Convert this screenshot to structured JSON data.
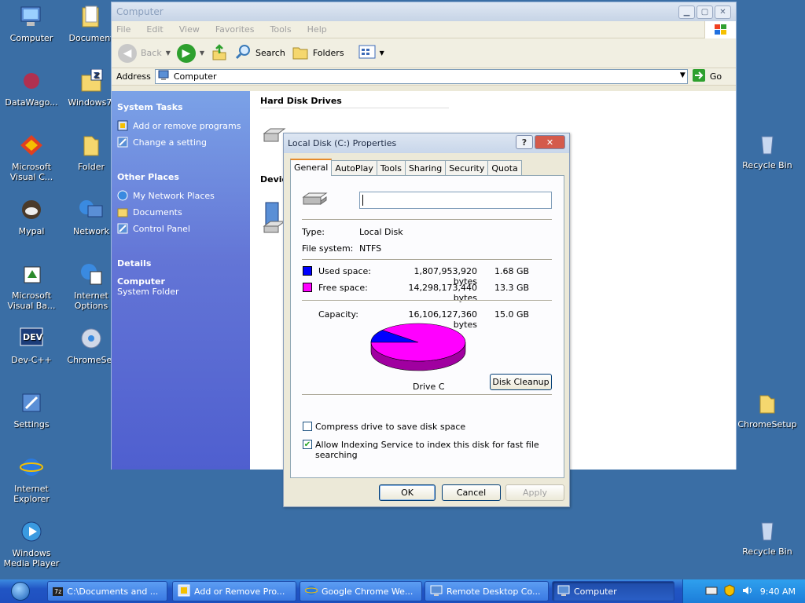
{
  "desktop": {
    "left_icons": [
      {
        "label": "Computer",
        "icon": "computer-icon"
      },
      {
        "label": "Document",
        "icon": "folder-documents-icon"
      },
      {
        "label": "DataWago...",
        "icon": "datawago-icon"
      },
      {
        "label": "Windows7I",
        "icon": "zip-archive-icon"
      },
      {
        "label": "Microsoft\nVisual C...",
        "icon": "visual-c-icon"
      },
      {
        "label": "Folder",
        "icon": "folder-icon"
      },
      {
        "label": "Mypal",
        "icon": "mypal-icon"
      },
      {
        "label": "Network",
        "icon": "network-icon"
      },
      {
        "label": "Microsoft\nVisual Ba...",
        "icon": "visual-basic-icon"
      },
      {
        "label": "Internet\nOptions",
        "icon": "internet-options-icon"
      },
      {
        "label": "Dev-C++",
        "icon": "devcpp-icon"
      },
      {
        "label": "ChromeSet",
        "icon": "chrome-setup-icon"
      },
      {
        "label": "Settings",
        "icon": "settings-icon"
      },
      {
        "label": "Internet\nExplorer",
        "icon": "internet-explorer-icon"
      },
      {
        "label": "Windows\nMedia Player",
        "icon": "media-player-icon"
      }
    ],
    "right_icons": [
      {
        "label": "Recycle Bin",
        "icon": "recycle-bin-icon"
      },
      {
        "label": "ChromeSetup",
        "icon": "folder-icon"
      },
      {
        "label": "Recycle Bin",
        "icon": "recycle-bin-icon"
      }
    ]
  },
  "explorer": {
    "title": "Computer",
    "menu": [
      "File",
      "Edit",
      "View",
      "Favorites",
      "Tools",
      "Help"
    ],
    "toolbar": {
      "back": "Back",
      "search": "Search",
      "folders": "Folders"
    },
    "address_label": "Address",
    "address_value": "Computer",
    "go_label": "Go",
    "task_pane": {
      "system_tasks_title": "System Tasks",
      "system_tasks": [
        "Add or remove programs",
        "Change a setting"
      ],
      "other_places_title": "Other Places",
      "other_places": [
        "My Network Places",
        "Documents",
        "Control Panel"
      ],
      "details_title": "Details",
      "details_name": "Computer",
      "details_type": "System Folder"
    },
    "sections": {
      "hard_disks": "Hard Disk Drives",
      "devices": "Devic"
    }
  },
  "dialog": {
    "title": "Local Disk (C:) Properties",
    "help_btn": "?",
    "close_btn": "✕",
    "tabs": [
      "General",
      "AutoPlay",
      "Tools",
      "Sharing",
      "Security",
      "Quota"
    ],
    "active_tab": "General",
    "name_value": "",
    "type_label": "Type:",
    "type_value": "Local Disk",
    "fs_label": "File system:",
    "fs_value": "NTFS",
    "used_label": "Used space:",
    "used_bytes": "1,807,953,920 bytes",
    "used_gb": "1.68 GB",
    "free_label": "Free space:",
    "free_bytes": "14,298,173,440 bytes",
    "free_gb": "13.3 GB",
    "capacity_label": "Capacity:",
    "capacity_bytes": "16,106,127,360 bytes",
    "capacity_gb": "15.0 GB",
    "drive_label": "Drive C",
    "cleanup_btn": "Disk Cleanup",
    "compress_label": "Compress drive to save disk space",
    "compress_checked": false,
    "index_label": "Allow Indexing Service to index this disk for fast file searching",
    "index_checked": true,
    "ok_btn": "OK",
    "cancel_btn": "Cancel",
    "apply_btn": "Apply",
    "colors": {
      "used": "#0000ff",
      "free": "#ff00ff"
    },
    "used_fraction": 0.112
  },
  "taskbar": {
    "buttons": [
      {
        "label": "C:\\Documents and ...",
        "icon": "7zip-icon",
        "active": false
      },
      {
        "label": "Add or Remove Pro...",
        "icon": "add-remove-icon",
        "active": false
      },
      {
        "label": "Google Chrome We...",
        "icon": "ie-icon",
        "active": false
      },
      {
        "label": "Remote Desktop Co...",
        "icon": "remote-desktop-icon",
        "active": false
      },
      {
        "label": "Computer",
        "icon": "computer-icon",
        "active": true
      }
    ],
    "clock": "9:40 AM"
  }
}
